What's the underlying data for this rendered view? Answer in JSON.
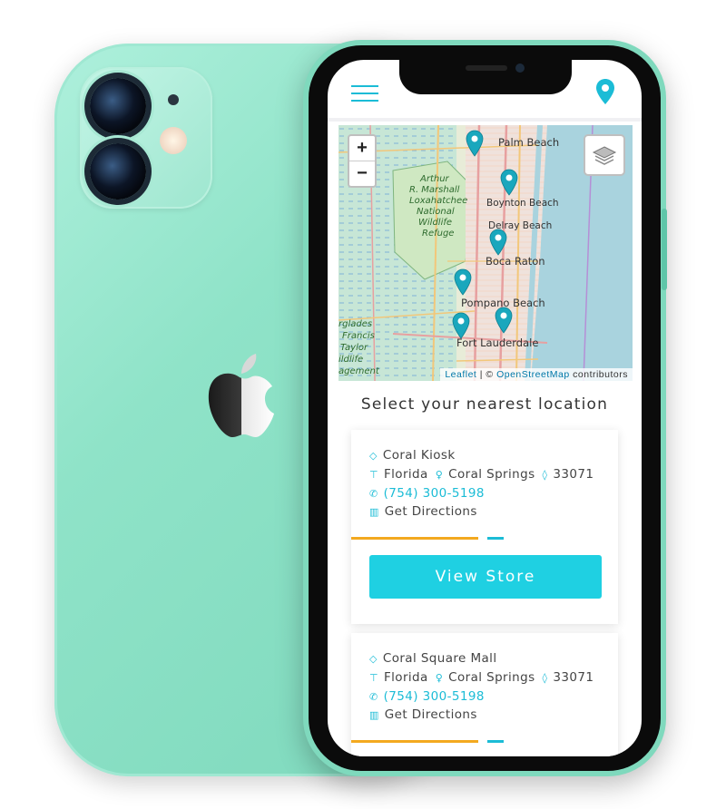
{
  "header": {
    "menu_icon": "hamburger-icon",
    "location_icon": "map-pin-icon",
    "accent_color": "#1bbcd6"
  },
  "map": {
    "zoom_in_label": "+",
    "zoom_out_label": "−",
    "layers_icon": "layers-icon",
    "attribution_leaflet": "Leaflet",
    "attribution_sep": " | © ",
    "attribution_osm": "OpenStreetMap",
    "attribution_suffix": " contributors",
    "labels": {
      "palm_beach": "Palm Beach",
      "boynton_beach": "Boynton Beach",
      "delray_beach": "Delray Beach",
      "boca_raton": "Boca Raton",
      "pompano_beach": "Pompano Beach",
      "fort_lauderdale": "Fort Lauderdale",
      "refuge_1": "Arthur",
      "refuge_2": "R. Marshall",
      "refuge_3": "Loxahatchee",
      "refuge_4": "National",
      "refuge_5": "Wildlife",
      "refuge_6": "Refuge",
      "ever_1": "rglades",
      "ever_2": "Francis",
      "ever_3": "Taylor",
      "ever_4": "ildlife",
      "ever_5": "agement"
    },
    "marker_color": "#1aa7bd"
  },
  "section_title": "Select your nearest location",
  "stores": [
    {
      "name": "Coral Kiosk",
      "state": "Florida",
      "city": "Coral Springs",
      "zip": "33071",
      "phone": "(754) 300-5198",
      "directions": "Get Directions",
      "button": "View Store"
    },
    {
      "name": "Coral Square Mall",
      "state": "Florida",
      "city": "Coral Springs",
      "zip": "33071",
      "phone": "(754) 300-5198",
      "directions": "Get Directions"
    }
  ],
  "colors": {
    "phone_body": "#8fe3c8",
    "button": "#1fd0e2",
    "progress_orange": "#f3a91f",
    "progress_blue": "#1bbcd6"
  }
}
